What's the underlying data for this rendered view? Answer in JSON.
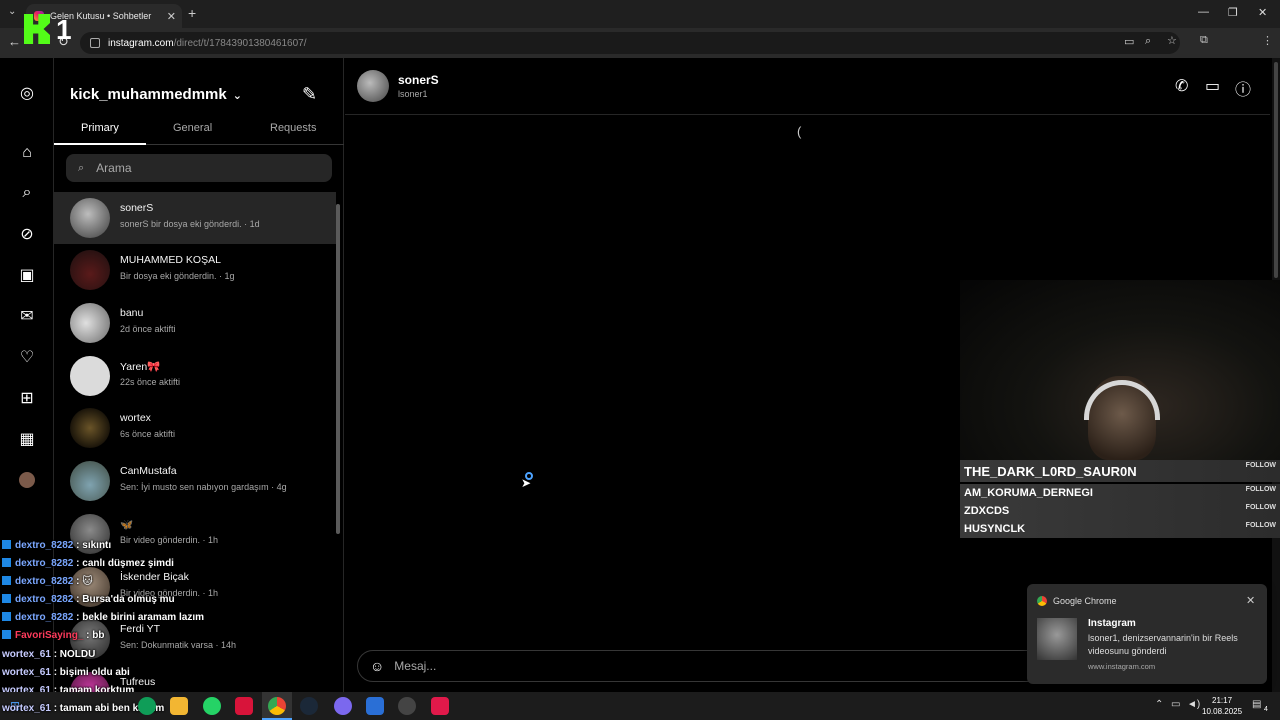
{
  "browser": {
    "tab_title": "Gelen Kutusu • Sohbetler",
    "new_tab": "+",
    "url_host": "instagram.com",
    "url_path": "/direct/t/17843901380461607/",
    "kick_overlay": "1"
  },
  "instagram": {
    "account": "kick_muhammedmmk",
    "tabs": [
      "Primary",
      "General",
      "Requests"
    ],
    "search_placeholder": "Arama",
    "conversations": [
      {
        "name": "sonerS",
        "sub": "sonerS bir dosya eki gönderdi. · 1d",
        "selected": true
      },
      {
        "name": "MUHAMMED KOŞAL",
        "sub": "Bir dosya eki gönderdin. · 1g"
      },
      {
        "name": "banu",
        "sub": "2d önce aktifti"
      },
      {
        "name": "Yaren🎀",
        "sub": "22s önce aktifti"
      },
      {
        "name": "wortex",
        "sub": "6s önce aktifti"
      },
      {
        "name": "CanMustafa",
        "sub": "Sen: İyi musto sen nabıyon gardaşım · 4g"
      },
      {
        "name": "🦋",
        "sub": "Bir video gönderdin. · 1h"
      },
      {
        "name": "İskender Biçak",
        "sub": "Bir video gönderdin. · 1h"
      },
      {
        "name": "Ferdi YT",
        "sub": "Sen: Dokunmatik varsa · 14h"
      },
      {
        "name": "Tufreus",
        "sub": ""
      }
    ],
    "chat": {
      "name": "sonerS",
      "username": "lsoner1",
      "loading_glyph": "(",
      "message_placeholder": "Mesaj..."
    }
  },
  "stream_overlay": {
    "follows": [
      {
        "name": "THE_DARK_L0RD_SAUR0N",
        "label": "FOLLOW"
      },
      {
        "name": "AM_KORUMA_DERNEGI",
        "label": "FOLLOW"
      },
      {
        "name": "ZDXCDS",
        "label": "FOLLOW"
      },
      {
        "name": "HUSYNCLK",
        "label": "FOLLOW"
      }
    ],
    "chat": [
      {
        "user": "dextro_8282",
        "text": ": sıkıntı"
      },
      {
        "user": "dextro_8282",
        "text": ": canlı düşmez şimdi"
      },
      {
        "user": "dextro_8282",
        "text": ":"
      },
      {
        "user": "dextro_8282",
        "text": ": Bursa'da olmuş mu"
      },
      {
        "user": "dextro_8282",
        "text": ": bekle birini aramam lazım"
      },
      {
        "user": "FavoriSaying_",
        "text": ": bb"
      },
      {
        "user": "wortex_61",
        "text": ": NOLDU"
      },
      {
        "user": "wortex_61",
        "text": ": bişimi oldu abi"
      },
      {
        "user": "wortex_61",
        "text": ": tamam korktum"
      },
      {
        "user": "wortex_61",
        "text": ": tamam abi ben kaçtım"
      }
    ]
  },
  "notification": {
    "app": "Google Chrome",
    "title": "Instagram",
    "body": "lsoner1, denizservannarin'in bir Reels videosunu gönderdi",
    "source": "www.instagram.com"
  },
  "taskbar": {
    "time": "21:17",
    "date": "10.08.2025",
    "notif_count": "4"
  }
}
